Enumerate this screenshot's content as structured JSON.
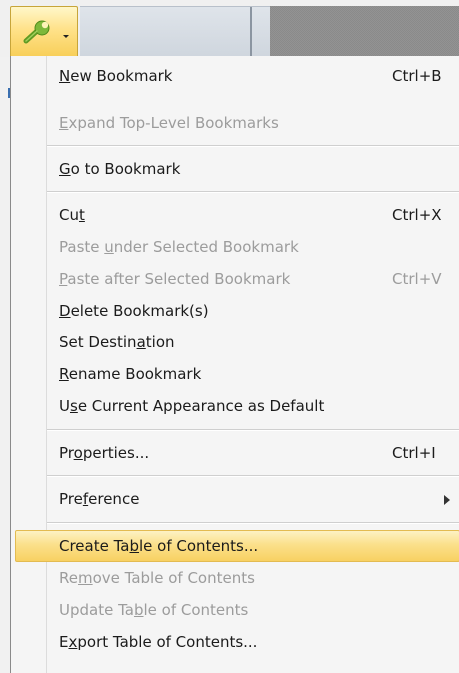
{
  "toolbar": {
    "options_button": {
      "icon": "wrench-icon",
      "accent": "#7db83a"
    }
  },
  "menu": {
    "highlight_color": "#fbe08b",
    "items": [
      {
        "before": "",
        "key": "N",
        "after": "ew Bookmark",
        "shortcut": "Ctrl+B",
        "disabled": false
      },
      {
        "before": "",
        "key": "E",
        "after": "xpand Top-Level Bookmarks",
        "shortcut": "",
        "disabled": true
      },
      {
        "before": "",
        "key": "G",
        "after": "o to Bookmark",
        "shortcut": "",
        "disabled": false
      },
      {
        "before": "Cu",
        "key": "t",
        "after": "",
        "shortcut": "Ctrl+X",
        "disabled": false
      },
      {
        "before": "Paste ",
        "key": "u",
        "after": "nder Selected Bookmark",
        "shortcut": "",
        "disabled": true
      },
      {
        "before": "",
        "key": "P",
        "after": "aste after Selected Bookmark",
        "shortcut": "Ctrl+V",
        "disabled": true
      },
      {
        "before": "",
        "key": "D",
        "after": "elete Bookmark(s)",
        "shortcut": "",
        "disabled": false
      },
      {
        "before": "Set Destin",
        "key": "a",
        "after": "tion",
        "shortcut": "",
        "disabled": false
      },
      {
        "before": "",
        "key": "R",
        "after": "ename Bookmark",
        "shortcut": "",
        "disabled": false
      },
      {
        "before": "U",
        "key": "s",
        "after": "e Current Appearance as Default",
        "shortcut": "",
        "disabled": false
      },
      {
        "before": "Pr",
        "key": "o",
        "after": "perties...",
        "shortcut": "Ctrl+I",
        "disabled": false
      },
      {
        "before": "Pre",
        "key": "f",
        "after": "erence",
        "shortcut": "",
        "disabled": false,
        "submenu": true
      },
      {
        "before": "Create Ta",
        "key": "b",
        "after": "le of Contents...",
        "shortcut": "",
        "disabled": false,
        "highlighted": true
      },
      {
        "before": "Re",
        "key": "m",
        "after": "ove Table of Contents",
        "shortcut": "",
        "disabled": true
      },
      {
        "before": "Update Ta",
        "key": "b",
        "after": "le of Contents",
        "shortcut": "",
        "disabled": true
      },
      {
        "before": "E",
        "key": "x",
        "after": "port Table of Contents...",
        "shortcut": "",
        "disabled": false
      }
    ]
  }
}
